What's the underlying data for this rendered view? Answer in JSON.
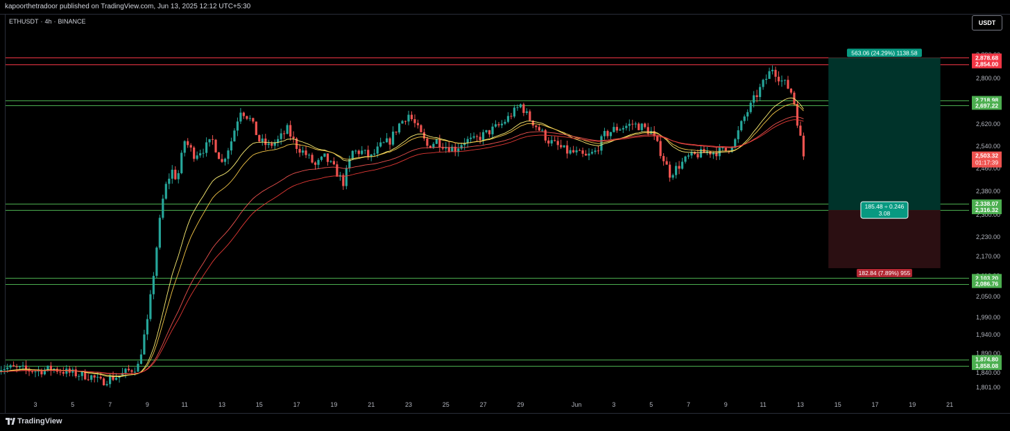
{
  "header": {
    "published_line": "kapoorthetradoor published on TradingView.com, Jun 13, 2025 12:12 UTC+5:30"
  },
  "symbol_bar": {
    "symbol": "ETHUSDT",
    "interval": "4h",
    "exchange": "BINANCE"
  },
  "currency_button": "USDT",
  "footer": {
    "brand": "TradingView"
  },
  "colors": {
    "background": "#000000",
    "bull": "#26a69a",
    "bear": "#ef5350",
    "resistance": "#f23645",
    "support": "#4caf50",
    "ema_fast": "#fff176",
    "ema_slow": "#ef5350",
    "long_target_zone": "#00332a",
    "long_stop_zone": "#2b0f12"
  },
  "chart_data": {
    "type": "candlestick",
    "symbol": "ETHUSDT",
    "timeframe": "4h",
    "y_axis": {
      "scale": "linear",
      "range": [
        1780,
        2950
      ],
      "ticks": [
        "1,801.00",
        "1,840.00",
        "1,890.00",
        "1,940.00",
        "1,990.00",
        "2,050.00",
        "2,110.00",
        "2,170.00",
        "2,230.00",
        "2,300.00",
        "2,380.00",
        "2,460.00",
        "2,540.00",
        "2,620.00",
        "2,710.00",
        "2,800.00",
        "2,890.00"
      ]
    },
    "x_axis": {
      "ticks": [
        "3",
        "5",
        "7",
        "9",
        "11",
        "13",
        "15",
        "17",
        "19",
        "21",
        "23",
        "25",
        "27",
        "29",
        "Jun",
        "3",
        "5",
        "7",
        "9",
        "11",
        "13",
        "15",
        "17",
        "19",
        "21"
      ],
      "tick_days": [
        3,
        5,
        7,
        9,
        11,
        13,
        15,
        17,
        19,
        21,
        23,
        25,
        27,
        29,
        32,
        34,
        36,
        38,
        40,
        42,
        44,
        46,
        48,
        50,
        52
      ]
    },
    "price_path": [
      [
        1.0,
        1855
      ],
      [
        2.0,
        1850
      ],
      [
        3.0,
        1845
      ],
      [
        4.0,
        1850
      ],
      [
        5.0,
        1838
      ],
      [
        6.0,
        1830
      ],
      [
        6.5,
        1815
      ],
      [
        7.0,
        1825
      ],
      [
        7.5,
        1832
      ],
      [
        8.0,
        1845
      ],
      [
        8.5,
        1858
      ],
      [
        9.0,
        1975
      ],
      [
        9.3,
        2100
      ],
      [
        9.6,
        2250
      ],
      [
        9.9,
        2380
      ],
      [
        10.3,
        2455
      ],
      [
        10.6,
        2420
      ],
      [
        11.0,
        2560
      ],
      [
        11.5,
        2510
      ],
      [
        12.0,
        2530
      ],
      [
        12.5,
        2560
      ],
      [
        13.0,
        2480
      ],
      [
        13.5,
        2560
      ],
      [
        14.0,
        2680
      ],
      [
        14.5,
        2640
      ],
      [
        15.0,
        2560
      ],
      [
        15.5,
        2540
      ],
      [
        16.0,
        2560
      ],
      [
        16.5,
        2600
      ],
      [
        17.0,
        2540
      ],
      [
        17.5,
        2510
      ],
      [
        18.0,
        2470
      ],
      [
        18.5,
        2500
      ],
      [
        19.0,
        2460
      ],
      [
        19.5,
        2410
      ],
      [
        20.0,
        2520
      ],
      [
        20.5,
        2520
      ],
      [
        21.0,
        2500
      ],
      [
        21.5,
        2540
      ],
      [
        22.0,
        2560
      ],
      [
        22.5,
        2620
      ],
      [
        23.0,
        2660
      ],
      [
        23.5,
        2600
      ],
      [
        24.0,
        2540
      ],
      [
        24.5,
        2560
      ],
      [
        25.0,
        2540
      ],
      [
        25.5,
        2530
      ],
      [
        26.0,
        2560
      ],
      [
        26.5,
        2560
      ],
      [
        27.0,
        2580
      ],
      [
        27.5,
        2600
      ],
      [
        28.0,
        2620
      ],
      [
        28.5,
        2660
      ],
      [
        29.0,
        2700
      ],
      [
        29.5,
        2640
      ],
      [
        30.0,
        2600
      ],
      [
        30.5,
        2560
      ],
      [
        31.0,
        2540
      ],
      [
        31.5,
        2520
      ],
      [
        32.0,
        2515
      ],
      [
        32.5,
        2500
      ],
      [
        33.0,
        2520
      ],
      [
        33.5,
        2580
      ],
      [
        34.0,
        2600
      ],
      [
        34.5,
        2610
      ],
      [
        35.0,
        2620
      ],
      [
        35.5,
        2610
      ],
      [
        36.0,
        2590
      ],
      [
        36.5,
        2520
      ],
      [
        37.0,
        2440
      ],
      [
        37.5,
        2470
      ],
      [
        38.0,
        2500
      ],
      [
        38.5,
        2510
      ],
      [
        39.0,
        2520
      ],
      [
        39.5,
        2520
      ],
      [
        40.0,
        2525
      ],
      [
        40.5,
        2560
      ],
      [
        41.0,
        2650
      ],
      [
        41.5,
        2720
      ],
      [
        42.0,
        2780
      ],
      [
        42.5,
        2840
      ],
      [
        43.0,
        2790
      ],
      [
        43.3,
        2770
      ],
      [
        43.6,
        2740
      ],
      [
        43.9,
        2600
      ],
      [
        44.2,
        2503.32
      ]
    ],
    "moving_averages": [
      {
        "name": "",
        "color": "#fff176"
      },
      {
        "name": "",
        "color": "#f7c948"
      },
      {
        "name": "",
        "color": "#ef5350"
      },
      {
        "name": "",
        "color": "#e53935"
      }
    ],
    "horizontal_levels": [
      {
        "value": 2878.68,
        "label": "2,878.68",
        "kind": "resistance"
      },
      {
        "value": 2854.0,
        "label": "2,854.00",
        "kind": "resistance"
      },
      {
        "value": 2718.98,
        "label": "2,718.98",
        "kind": "support"
      },
      {
        "value": 2697.22,
        "label": "2,697.22",
        "kind": "support"
      },
      {
        "value": 2338.07,
        "label": "2,338.07",
        "kind": "support"
      },
      {
        "value": 2316.32,
        "label": "2,316.32",
        "kind": "support"
      },
      {
        "value": 2103.2,
        "label": "2,103.20",
        "kind": "support"
      },
      {
        "value": 2086.76,
        "label": "2,086.76",
        "kind": "support"
      },
      {
        "value": 1874.8,
        "label": "1,874.80",
        "kind": "support"
      },
      {
        "value": 1858.08,
        "label": "1,858.08",
        "kind": "support"
      }
    ],
    "last_price": {
      "value": 2503.32,
      "label": "2,503.32",
      "countdown": "01:17:39"
    },
    "long_position": {
      "entry": 2316.32,
      "target": 2878.68,
      "stop": 2133.48,
      "start_day": 45.5,
      "end_day": 51.5,
      "target_label": "563.06 (24.29%) 1138.58",
      "entry_label_line1": "185.48 ÷ 0.246",
      "entry_label_line2": "3.08",
      "stop_label": "182.84 (7.89%) 955"
    }
  }
}
